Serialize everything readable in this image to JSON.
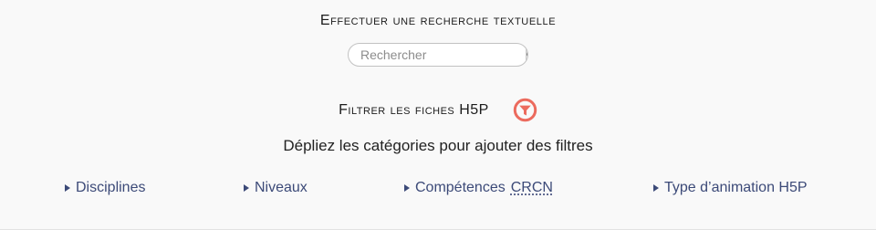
{
  "search": {
    "title": "Effectuer une recherche textuelle",
    "placeholder": "Rechercher",
    "button_icon": "search-icon"
  },
  "filter": {
    "title": "Filtrer les fiches H5P",
    "icon": "filter-icon",
    "icon_color": "#ec6b5e"
  },
  "instructions": "Dépliez les catégories pour ajouter des filtres",
  "categories": [
    {
      "label": "Disciplines"
    },
    {
      "label": "Niveaux"
    },
    {
      "label": "Compétences",
      "abbr": "CRCN"
    },
    {
      "label": "Type d’animation H5P"
    }
  ],
  "colors": {
    "category_text": "#3c4a78",
    "background": "#f9f9f9"
  }
}
